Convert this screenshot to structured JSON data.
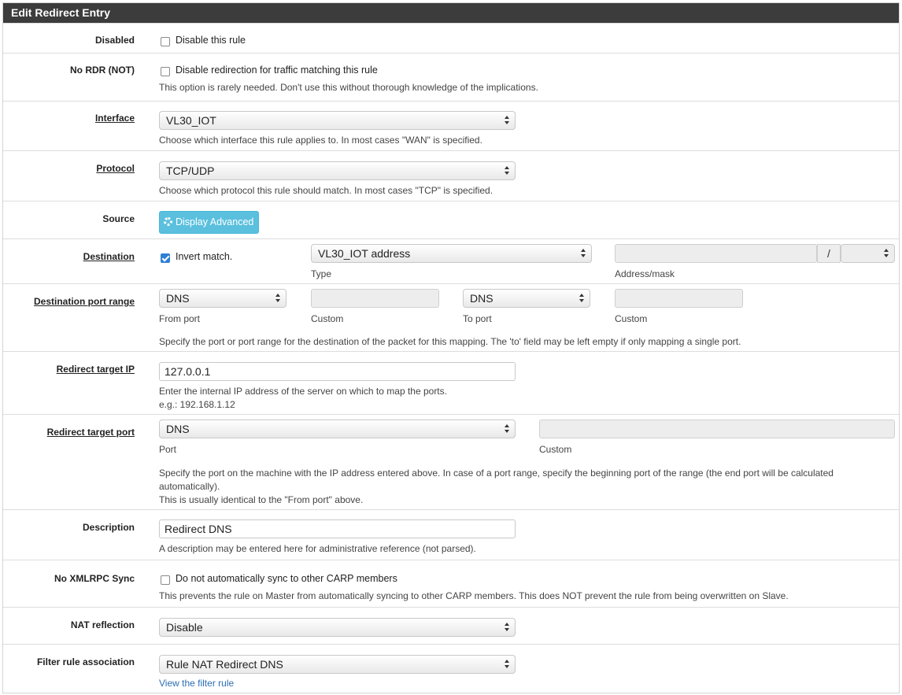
{
  "panel": {
    "title": "Edit Redirect Entry"
  },
  "disabled": {
    "label": "Disabled",
    "checkbox_label": "Disable this rule",
    "checked": false
  },
  "no_rdr": {
    "label": "No RDR (NOT)",
    "checkbox_label": "Disable redirection for traffic matching this rule",
    "help": "This option is rarely needed. Don't use this without thorough knowledge of the implications.",
    "checked": false
  },
  "interface": {
    "label": "Interface",
    "value": "VL30_IOT",
    "help": "Choose which interface this rule applies to. In most cases \"WAN\" is specified."
  },
  "protocol": {
    "label": "Protocol",
    "value": "TCP/UDP",
    "help": "Choose which protocol this rule should match. In most cases \"TCP\" is specified."
  },
  "source": {
    "label": "Source",
    "button_label": "Display Advanced"
  },
  "destination": {
    "label": "Destination",
    "invert_label": "Invert match.",
    "invert_checked": true,
    "type_value": "VL30_IOT address",
    "type_caption": "Type",
    "address_value": "",
    "slash": "/",
    "mask_value": "",
    "address_caption": "Address/mask"
  },
  "dest_port_range": {
    "label": "Destination port range",
    "from_value": "DNS",
    "from_caption": "From port",
    "from_custom_caption": "Custom",
    "to_value": "DNS",
    "to_caption": "To port",
    "to_custom_caption": "Custom",
    "help": "Specify the port or port range for the destination of the packet for this mapping. The 'to' field may be left empty if only mapping a single port."
  },
  "redirect_ip": {
    "label": "Redirect target IP",
    "value": "127.0.0.1",
    "help": "Enter the internal IP address of the server on which to map the ports.",
    "example": "e.g.: 192.168.1.12"
  },
  "redirect_port": {
    "label": "Redirect target port",
    "value": "DNS",
    "port_caption": "Port",
    "custom_caption": "Custom",
    "help_line1": "Specify the port on the machine with the IP address entered above. In case of a port range, specify the beginning port of the range (the end port will be calculated",
    "help_line2": "automatically).",
    "help_line3": "This is usually identical to the \"From port\" above."
  },
  "description": {
    "label": "Description",
    "value": "Redirect DNS",
    "help": "A description may be entered here for administrative reference (not parsed)."
  },
  "xmlrpc": {
    "label": "No XMLRPC Sync",
    "checkbox_label": "Do not automatically sync to other CARP members",
    "help": "This prevents the rule on Master from automatically syncing to other CARP members. This does NOT prevent the rule from being overwritten on Slave.",
    "checked": false
  },
  "nat_reflection": {
    "label": "NAT reflection",
    "value": "Disable"
  },
  "filter_rule": {
    "label": "Filter rule association",
    "value": "Rule NAT Redirect DNS",
    "link_label": "View the filter rule"
  },
  "colors": {
    "header_bg": "#3c3c3c",
    "info_button": "#5bc0de",
    "link": "#2a6eb3",
    "checkbox_checked": "#2f7fd4"
  }
}
